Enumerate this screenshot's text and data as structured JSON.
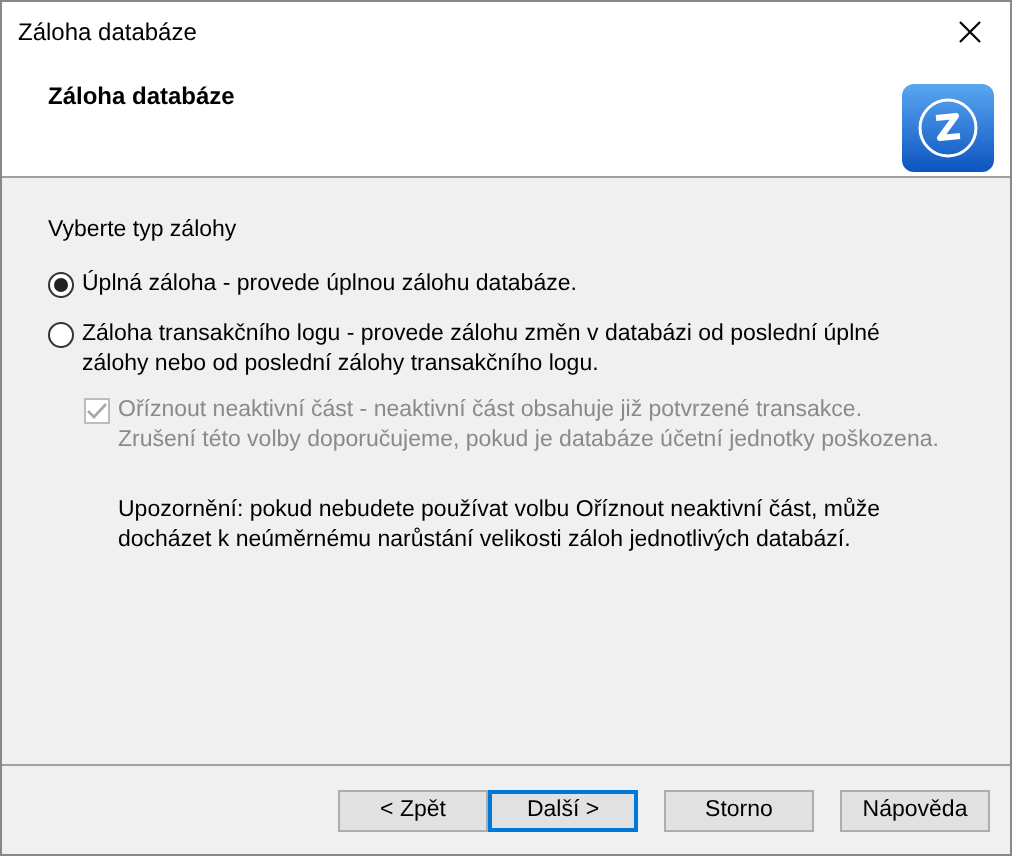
{
  "window": {
    "title": "Záloha databáze"
  },
  "header": {
    "title": "Záloha databáze"
  },
  "prompt": "Vyberte typ zálohy",
  "options": [
    {
      "label": "Úplná záloha - provede úplnou zálohu databáze.",
      "selected": true
    },
    {
      "label": "Záloha transakčního logu - provede zálohu změn v databázi od poslední úplné\nzálohy nebo od poslední zálohy transakčního logu.",
      "selected": false
    }
  ],
  "truncate_option": {
    "label": "Oříznout neaktivní část - neaktivní část obsahuje již potvrzené transakce.\nZrušení této volby doporučujeme, pokud je databáze účetní jednotky poškozena.",
    "checked": true,
    "disabled": true
  },
  "warning": "Upozornění: pokud nebudete používat volbu Oříznout neaktivní část, může\ndocházet k neúměrnému narůstání velikosti záloh jednotlivých databází.",
  "buttons": [
    {
      "label": "< Zpět",
      "focused": false
    },
    {
      "label": "Další >",
      "focused": true
    },
    {
      "label": "Storno",
      "focused": false
    },
    {
      "label": "Nápověda",
      "focused": false
    }
  ]
}
